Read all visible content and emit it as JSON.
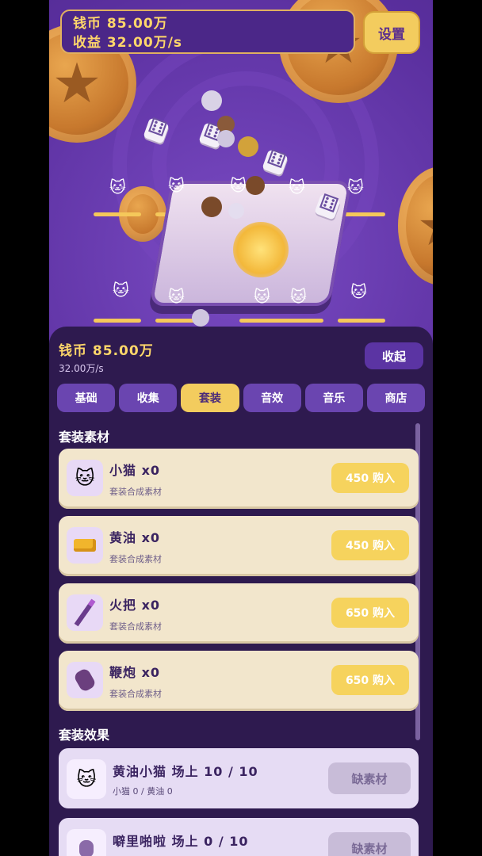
{
  "top": {
    "coins_line": "钱币 85.00万",
    "income_line": "收益 32.00万/s",
    "settings_label": "设置"
  },
  "panel": {
    "coins_line": "钱币 85.00万",
    "rate_line": "32.00万/s",
    "collapse_label": "收起",
    "tabs": [
      {
        "label": "基础"
      },
      {
        "label": "收集"
      },
      {
        "label": "套装"
      },
      {
        "label": "音效"
      },
      {
        "label": "音乐"
      },
      {
        "label": "商店"
      }
    ],
    "active_tab": "套装",
    "materials_title": "套装素材",
    "materials": [
      {
        "name": "小猫  x0",
        "desc": "套装合成素材",
        "buy": "450 购入",
        "icon": "cat-icon"
      },
      {
        "name": "黄油  x0",
        "desc": "套装合成素材",
        "buy": "450 购入",
        "icon": "butter-icon"
      },
      {
        "name": "火把  x0",
        "desc": "套装合成素材",
        "buy": "650 购入",
        "icon": "torch-icon"
      },
      {
        "name": "鞭炮  x0",
        "desc": "套装合成素材",
        "buy": "650 购入",
        "icon": "firecracker-icon"
      }
    ],
    "effects_title": "套装效果",
    "effects": [
      {
        "name": "黄油小猫  场上 10 / 10",
        "desc": "小猫 0 / 黄油 0",
        "status": "缺素材",
        "icon": "butter-cat-icon"
      },
      {
        "name": "噼里啪啦  场上 0 / 10",
        "desc": "",
        "status": "缺素材",
        "icon": "firecracker-icon"
      }
    ]
  },
  "colors": {
    "accent_gold": "#f3cc5e",
    "panel_bg": "#2e1a4f",
    "tab_bg": "#6a45b0",
    "card_bg": "#f2e6cc"
  }
}
